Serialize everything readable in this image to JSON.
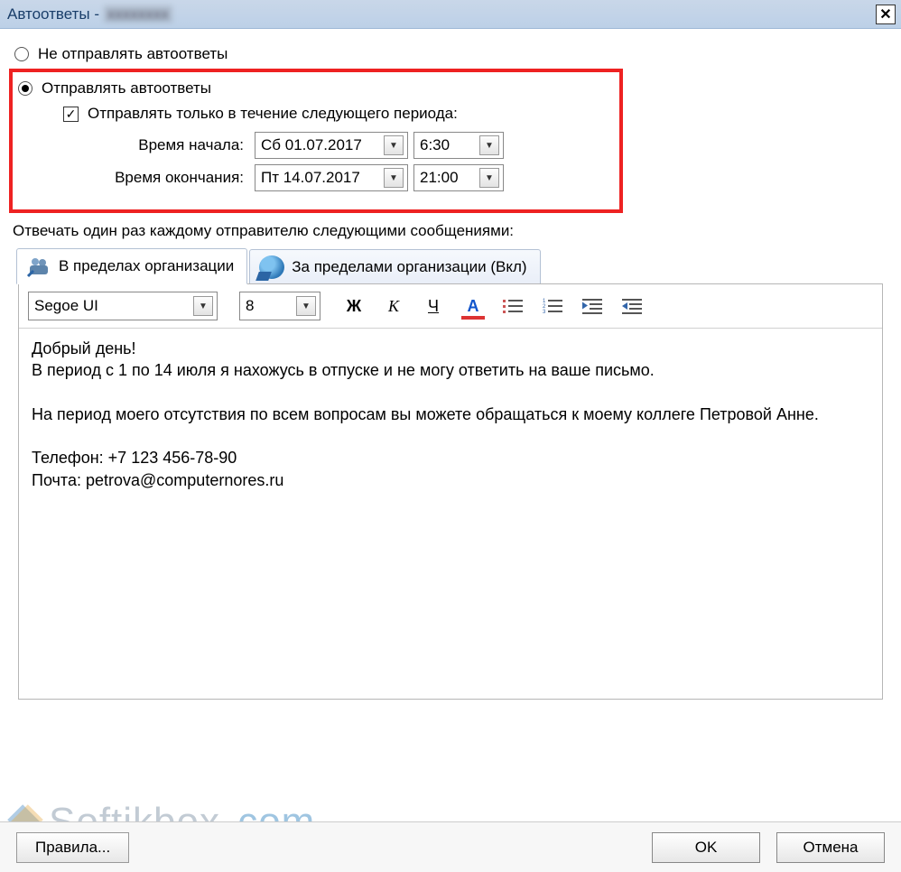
{
  "window": {
    "title": "Автоответы -",
    "title_smudge": "xxxxxxxx"
  },
  "options": {
    "do_not_send": "Не отправлять автоответы",
    "send": "Отправлять автоответы",
    "send_only_period": "Отправлять только в течение следующего периода:",
    "start_label": "Время начала:",
    "end_label": "Время окончания:",
    "start_date": "Сб 01.07.2017",
    "start_time": "6:30",
    "end_date": "Пт 14.07.2017",
    "end_time": "21:00",
    "check_mark": "✓"
  },
  "reply_label": "Отвечать один раз каждому отправителю следующими сообщениями:",
  "tabs": {
    "inside": "В пределах организации",
    "outside": "За пределами организации (Вкл)"
  },
  "toolbar": {
    "font": "Segoe UI",
    "size": "8",
    "bold": "Ж",
    "italic": "К",
    "underline": "Ч",
    "fontcolor": "А"
  },
  "message": "Добрый день!\nВ период с 1 по 14 июля я нахожусь в отпуске и не могу ответить на ваше письмо.\n\nНа период моего отсутствия по всем вопросам вы можете обращаться к моему коллеге Петровой Анне.\n\nТелефон: +7 123 456-78-90\nПочта: petrova@computernores.ru",
  "footer": {
    "rules": "Правила...",
    "ok": "OK",
    "cancel": "Отмена"
  },
  "watermark": {
    "t1": "Softikbox",
    "t2": ".com"
  }
}
